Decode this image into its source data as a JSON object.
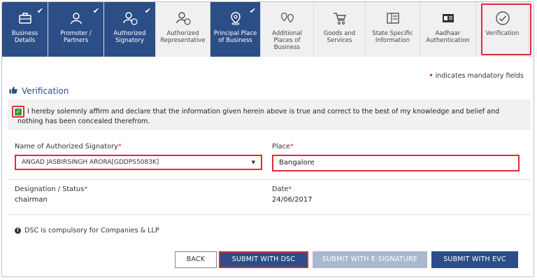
{
  "tabs": [
    {
      "label": "Business Details",
      "icon": "briefcase-icon",
      "state": "done"
    },
    {
      "label": "Promoter / Partners",
      "icon": "person-icon",
      "state": "done"
    },
    {
      "label": "Authorized Signatory",
      "icon": "person-edit-icon",
      "state": "done"
    },
    {
      "label": "Authorized Representative",
      "icon": "person-edit-icon",
      "state": "pending"
    },
    {
      "label": "Principal Place of Business",
      "icon": "location-pin-icon",
      "state": "done"
    },
    {
      "label": "Additional Places of Business",
      "icon": "multi-location-icon",
      "state": "pending"
    },
    {
      "label": "Goods and Services",
      "icon": "cart-icon",
      "state": "pending"
    },
    {
      "label": "State Specific Information",
      "icon": "form-grid-icon",
      "state": "pending"
    },
    {
      "label": "Aadhaar Authentication",
      "icon": "id-card-icon",
      "state": "pending"
    },
    {
      "label": "Verification",
      "icon": "check-circle-icon",
      "state": "active"
    }
  ],
  "mandatory_note": "indicates mandatory fields",
  "section_title": "Verification",
  "affirmation": {
    "line1": "I hereby solemnly affirm and declare that the information given herein above is true and correct to the best of my knowledge and belief and",
    "line2": "nothing has been concealed therefrom.",
    "checked": true
  },
  "signatory": {
    "label": "Name of Authorized Signatory",
    "value": "ANGAD JASBIRSINGH ARORA[GDDPS5083K]"
  },
  "place": {
    "label": "Place",
    "value": "Bangalore"
  },
  "designation": {
    "label": "Designation / Status",
    "value": "chairman"
  },
  "date": {
    "label": "Date",
    "value": "24/06/2017"
  },
  "info_note": "DSC is compulsory for Companies & LLP",
  "buttons": {
    "back": "BACK",
    "submit_dsc": "SUBMIT WITH DSC",
    "submit_esig": "SUBMIT WITH E-SIGNATURE",
    "submit_evc": "SUBMIT WITH EVC"
  },
  "colors": {
    "primary": "#2c4e86",
    "highlight": "#e3283a",
    "disabled": "#a9b8ce"
  }
}
